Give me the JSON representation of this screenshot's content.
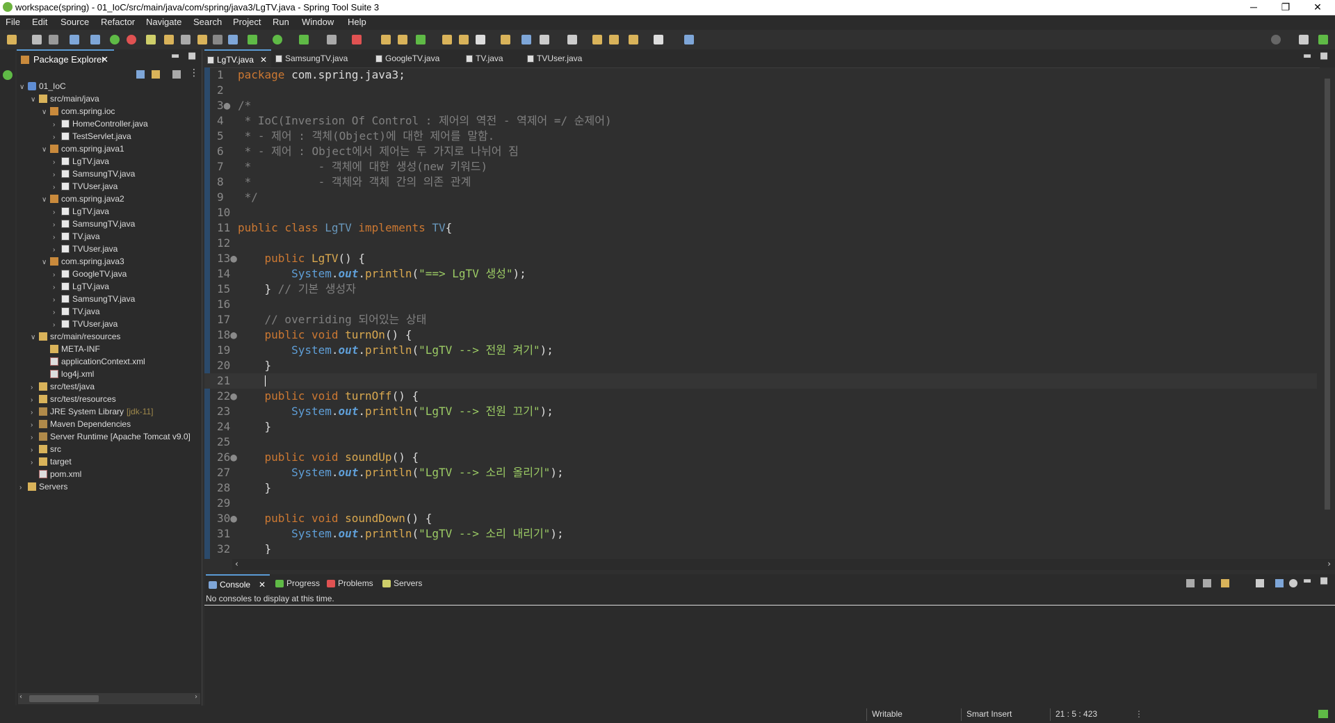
{
  "window": {
    "title": "workspace(spring) - 01_IoC/src/main/java/com/spring/java3/LgTV.java - Spring Tool Suite 3",
    "minimize": "─",
    "maximize": "❐",
    "close": "✕"
  },
  "menu": [
    "File",
    "Edit",
    "Source",
    "Refactor",
    "Navigate",
    "Search",
    "Project",
    "Run",
    "Window",
    "Help"
  ],
  "package_explorer": {
    "title": "Package Explorer",
    "tree": [
      {
        "label": "01_IoC",
        "tw": "∨",
        "icon": "proj",
        "depth": 0
      },
      {
        "label": "src/main/java",
        "tw": "∨",
        "icon": "folder",
        "depth": 1
      },
      {
        "label": "com.spring.ioc",
        "tw": "∨",
        "icon": "pkg",
        "depth": 2
      },
      {
        "label": "HomeController.java",
        "tw": "›",
        "icon": "java",
        "depth": 3
      },
      {
        "label": "TestServlet.java",
        "tw": "›",
        "icon": "java",
        "depth": 3
      },
      {
        "label": "com.spring.java1",
        "tw": "∨",
        "icon": "pkg",
        "depth": 2
      },
      {
        "label": "LgTV.java",
        "tw": "›",
        "icon": "java",
        "depth": 3
      },
      {
        "label": "SamsungTV.java",
        "tw": "›",
        "icon": "java",
        "depth": 3
      },
      {
        "label": "TVUser.java",
        "tw": "›",
        "icon": "java",
        "depth": 3
      },
      {
        "label": "com.spring.java2",
        "tw": "∨",
        "icon": "pkg",
        "depth": 2
      },
      {
        "label": "LgTV.java",
        "tw": "›",
        "icon": "java",
        "depth": 3
      },
      {
        "label": "SamsungTV.java",
        "tw": "›",
        "icon": "java",
        "depth": 3
      },
      {
        "label": "TV.java",
        "tw": "›",
        "icon": "java",
        "depth": 3
      },
      {
        "label": "TVUser.java",
        "tw": "›",
        "icon": "java",
        "depth": 3
      },
      {
        "label": "com.spring.java3",
        "tw": "∨",
        "icon": "pkg",
        "depth": 2
      },
      {
        "label": "GoogleTV.java",
        "tw": "›",
        "icon": "java",
        "depth": 3
      },
      {
        "label": "LgTV.java",
        "tw": "›",
        "icon": "java",
        "depth": 3
      },
      {
        "label": "SamsungTV.java",
        "tw": "›",
        "icon": "java",
        "depth": 3
      },
      {
        "label": "TV.java",
        "tw": "›",
        "icon": "java",
        "depth": 3
      },
      {
        "label": "TVUser.java",
        "tw": "›",
        "icon": "java",
        "depth": 3
      },
      {
        "label": "src/main/resources",
        "tw": "∨",
        "icon": "folder",
        "depth": 1
      },
      {
        "label": "META-INF",
        "tw": "",
        "icon": "folder",
        "depth": 2
      },
      {
        "label": "applicationContext.xml",
        "tw": "",
        "icon": "xml",
        "depth": 2
      },
      {
        "label": "log4j.xml",
        "tw": "",
        "icon": "xml",
        "depth": 2
      },
      {
        "label": "src/test/java",
        "tw": "›",
        "icon": "folder",
        "depth": 1
      },
      {
        "label": "src/test/resources",
        "tw": "›",
        "icon": "folder",
        "depth": 1
      },
      {
        "label": "JRE System Library",
        "suffix": "[jdk-11]",
        "tw": "›",
        "icon": "lib",
        "depth": 1
      },
      {
        "label": "Maven Dependencies",
        "tw": "›",
        "icon": "lib",
        "depth": 1
      },
      {
        "label": "Server Runtime [Apache Tomcat v9.0]",
        "tw": "›",
        "icon": "lib",
        "depth": 1
      },
      {
        "label": "src",
        "tw": "›",
        "icon": "folder",
        "depth": 1
      },
      {
        "label": "target",
        "tw": "›",
        "icon": "folder",
        "depth": 1
      },
      {
        "label": "pom.xml",
        "tw": "",
        "icon": "xml",
        "depth": 1
      },
      {
        "label": "Servers",
        "tw": "›",
        "icon": "folder",
        "depth": 0
      }
    ]
  },
  "editor": {
    "tabs": [
      "LgTV.java",
      "SamsungTV.java",
      "GoogleTV.java",
      "TV.java",
      "TVUser.java"
    ],
    "active_tab": 0,
    "lines": [
      {
        "n": "1",
        "parts": [
          [
            "kw",
            "package "
          ],
          [
            "def",
            "com.spring.java3;"
          ]
        ]
      },
      {
        "n": "2",
        "parts": []
      },
      {
        "n": "3●",
        "parts": [
          [
            "cm",
            "/*"
          ]
        ]
      },
      {
        "n": "4",
        "parts": [
          [
            "cm",
            " * IoC(Inversion Of Control : 제어의 역전 - 역제어 =/ 순제어)"
          ]
        ]
      },
      {
        "n": "5",
        "parts": [
          [
            "cm",
            " * - 제어 : 객체(Object)에 대한 제어를 말함."
          ]
        ]
      },
      {
        "n": "6",
        "parts": [
          [
            "cm",
            " * - 제어 : Object에서 제어는 두 가지로 나뉘어 짐"
          ]
        ]
      },
      {
        "n": "7",
        "parts": [
          [
            "cm",
            " *          - 객체에 대한 생성(new 키워드)"
          ]
        ]
      },
      {
        "n": "8",
        "parts": [
          [
            "cm",
            " *          - 객체와 객체 간의 의존 관계"
          ]
        ]
      },
      {
        "n": "9",
        "parts": [
          [
            "cm",
            " */"
          ]
        ]
      },
      {
        "n": "10",
        "parts": []
      },
      {
        "n": "11",
        "parts": [
          [
            "kw",
            "public class "
          ],
          [
            "cls",
            "LgTV "
          ],
          [
            "kw",
            "implements "
          ],
          [
            "cls",
            "TV"
          ],
          [
            "def",
            "{"
          ]
        ]
      },
      {
        "n": "12",
        "parts": []
      },
      {
        "n": "13●",
        "parts": [
          [
            "def",
            "    "
          ],
          [
            "kw",
            "public "
          ],
          [
            "fn",
            "LgTV"
          ],
          [
            "def",
            "() {"
          ]
        ]
      },
      {
        "n": "14",
        "parts": [
          [
            "def",
            "        "
          ],
          [
            "sys",
            "System"
          ],
          [
            "def",
            "."
          ],
          [
            "fld",
            "out"
          ],
          [
            "def",
            "."
          ],
          [
            "fn",
            "println"
          ],
          [
            "def",
            "("
          ],
          [
            "str",
            "\"==> LgTV 생성\""
          ],
          [
            "def",
            ");"
          ]
        ]
      },
      {
        "n": "15",
        "parts": [
          [
            "def",
            "    } "
          ],
          [
            "cm",
            "// 기본 생성자"
          ]
        ]
      },
      {
        "n": "16",
        "parts": []
      },
      {
        "n": "17",
        "parts": [
          [
            "def",
            "    "
          ],
          [
            "cm",
            "// overriding 되어있는 상태"
          ]
        ]
      },
      {
        "n": "18●",
        "parts": [
          [
            "def",
            "    "
          ],
          [
            "kw",
            "public void "
          ],
          [
            "fn",
            "turnOn"
          ],
          [
            "def",
            "() {"
          ]
        ]
      },
      {
        "n": "19",
        "parts": [
          [
            "def",
            "        "
          ],
          [
            "sys",
            "System"
          ],
          [
            "def",
            "."
          ],
          [
            "fld",
            "out"
          ],
          [
            "def",
            "."
          ],
          [
            "fn",
            "println"
          ],
          [
            "def",
            "("
          ],
          [
            "str",
            "\"LgTV --> 전원 켜기\""
          ],
          [
            "def",
            ");"
          ]
        ]
      },
      {
        "n": "20",
        "parts": [
          [
            "def",
            "    }"
          ]
        ]
      },
      {
        "n": "21",
        "parts": [
          [
            "def",
            "    "
          ]
        ],
        "cur": true
      },
      {
        "n": "22●",
        "parts": [
          [
            "def",
            "    "
          ],
          [
            "kw",
            "public void "
          ],
          [
            "fn",
            "turnOff"
          ],
          [
            "def",
            "() {"
          ]
        ]
      },
      {
        "n": "23",
        "parts": [
          [
            "def",
            "        "
          ],
          [
            "sys",
            "System"
          ],
          [
            "def",
            "."
          ],
          [
            "fld",
            "out"
          ],
          [
            "def",
            "."
          ],
          [
            "fn",
            "println"
          ],
          [
            "def",
            "("
          ],
          [
            "str",
            "\"LgTV --> 전원 끄기\""
          ],
          [
            "def",
            ");"
          ]
        ]
      },
      {
        "n": "24",
        "parts": [
          [
            "def",
            "    }"
          ]
        ]
      },
      {
        "n": "25",
        "parts": []
      },
      {
        "n": "26●",
        "parts": [
          [
            "def",
            "    "
          ],
          [
            "kw",
            "public void "
          ],
          [
            "fn",
            "soundUp"
          ],
          [
            "def",
            "() {"
          ]
        ]
      },
      {
        "n": "27",
        "parts": [
          [
            "def",
            "        "
          ],
          [
            "sys",
            "System"
          ],
          [
            "def",
            "."
          ],
          [
            "fld",
            "out"
          ],
          [
            "def",
            "."
          ],
          [
            "fn",
            "println"
          ],
          [
            "def",
            "("
          ],
          [
            "str",
            "\"LgTV --> 소리 올리기\""
          ],
          [
            "def",
            ");"
          ]
        ]
      },
      {
        "n": "28",
        "parts": [
          [
            "def",
            "    }"
          ]
        ]
      },
      {
        "n": "29",
        "parts": []
      },
      {
        "n": "30●",
        "parts": [
          [
            "def",
            "    "
          ],
          [
            "kw",
            "public void "
          ],
          [
            "fn",
            "soundDown"
          ],
          [
            "def",
            "() {"
          ]
        ]
      },
      {
        "n": "31",
        "parts": [
          [
            "def",
            "        "
          ],
          [
            "sys",
            "System"
          ],
          [
            "def",
            "."
          ],
          [
            "fld",
            "out"
          ],
          [
            "def",
            "."
          ],
          [
            "fn",
            "println"
          ],
          [
            "def",
            "("
          ],
          [
            "str",
            "\"LgTV --> 소리 내리기\""
          ],
          [
            "def",
            ");"
          ]
        ]
      },
      {
        "n": "32",
        "parts": [
          [
            "def",
            "    }"
          ]
        ]
      }
    ]
  },
  "console": {
    "tabs": [
      "Console",
      "Progress",
      "Problems",
      "Servers"
    ],
    "message": "No consoles to display at this time."
  },
  "status": {
    "writable": "Writable",
    "insert_mode": "Smart Insert",
    "position": "21 : 5 : 423"
  },
  "colors": {
    "accent": "#5b9bd5",
    "keyword": "#cc7832",
    "string": "#9ccc65",
    "comment": "#808080"
  }
}
